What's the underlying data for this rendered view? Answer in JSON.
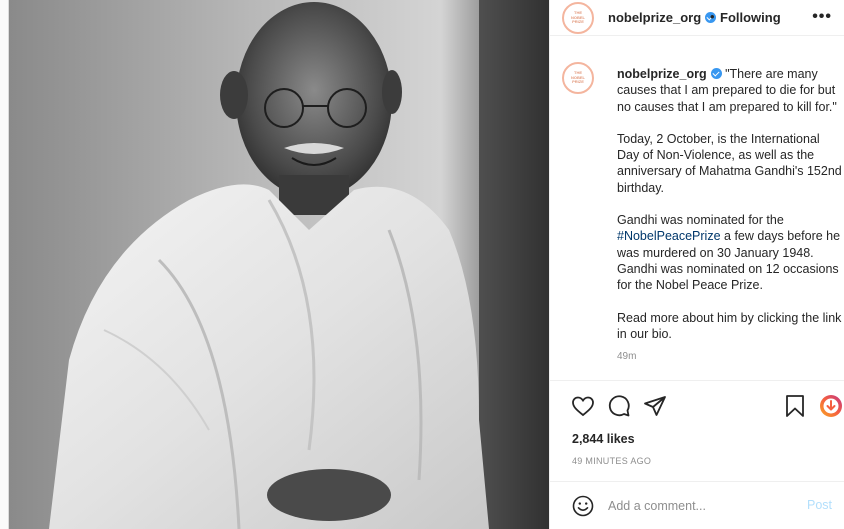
{
  "header": {
    "avatar_text": [
      "THE",
      "NOBEL",
      "PRIZE"
    ],
    "username": "nobelprize_org",
    "separator": "•",
    "follow_status": "Following",
    "more_icon": "more-options-icon"
  },
  "caption": {
    "username": "nobelprize_org",
    "quote": "\"There are many causes that I am prepared to die for but no causes that I am prepared to kill for.\"",
    "paragraph2": "Today, 2 October, is the International Day of Non-Violence, as well as the anniversary of Mahatma Gandhi's 152nd birthday.",
    "paragraph3_before": "Gandhi was nominated for the ",
    "hashtag": "#NobelPeacePrize",
    "paragraph3_after": " a few days before he was murdered on 30 January 1948. Gandhi was nominated on 12 occasions for the Nobel Peace Prize.",
    "paragraph4": "Read more about him by clicking the link in our bio.",
    "time_ago": "49m"
  },
  "actions": {
    "icons": [
      "heart-icon",
      "comment-icon",
      "share-icon",
      "bookmark-icon",
      "emoji-reaction-icon"
    ]
  },
  "likes": "2,844 likes",
  "posted": "49 MINUTES AGO",
  "comment": {
    "placeholder": "Add a comment...",
    "post_label": "Post"
  },
  "colors": {
    "hashtag": "#00376b",
    "post_button": "#b2dffc",
    "verified": "#3897f0",
    "avatar_ring": "#f4b59e"
  }
}
